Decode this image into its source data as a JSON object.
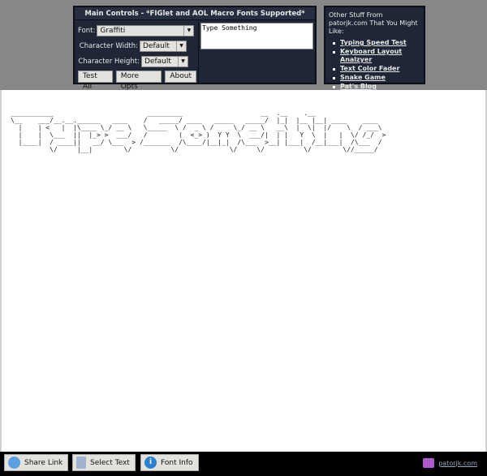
{
  "main": {
    "title": "Main Controls - *FIGlet and AOL Macro Fonts Supported*",
    "font_label": "Font:",
    "font_value": "Graffiti",
    "width_label": "Character Width:",
    "width_value": "Default",
    "height_label": "Character Height:",
    "height_value": "Default",
    "buttons": {
      "test_all": "Test All",
      "more_opts": "More Opts",
      "about": "About"
    },
    "input_text": "Type Something"
  },
  "other": {
    "heading": "Other Stuff From patorjk.com That You Might Like:",
    "links": [
      "Typing Speed Test",
      "Keyboard Layout Analzyer",
      "Text Color Fader",
      "Snake Game",
      "Pat's Blog"
    ]
  },
  "output": {
    "lines": [
      "___________                        _________                    __  .__    .__",
      "\\__    ___/__.__.______   ____    /   _____/ ____   _____   _____/  |_|  |__ |__| ____    ____",
      "  |    | <   |  |\\____ \\_/ __ \\   \\_____  \\ /  _ \\ /     \\_/ __ \\   __\\  |  \\|  |/    \\  / ___\\",
      "  |    |  \\___  ||  |_> >  ___/   /        (  <_> )  Y Y  \\  ___/|  | |   Y  \\  |   |  \\/ /_/  >",
      "  |____|  / ____||   __/ \\___  > /_______  /\\____/|__|_|  /\\___  >__| |___|  /__|___|  /\\___  /",
      "          \\/     |__|        \\/          \\/             \\/     \\/          \\/        \\//_____/"
    ]
  },
  "bottom": {
    "share": "Share Link",
    "select": "Select Text",
    "info": "Font Info",
    "brand": "patorjk.com"
  },
  "colors": {
    "panel": "#1f2635",
    "background": "#878787",
    "bar": "#000000"
  }
}
